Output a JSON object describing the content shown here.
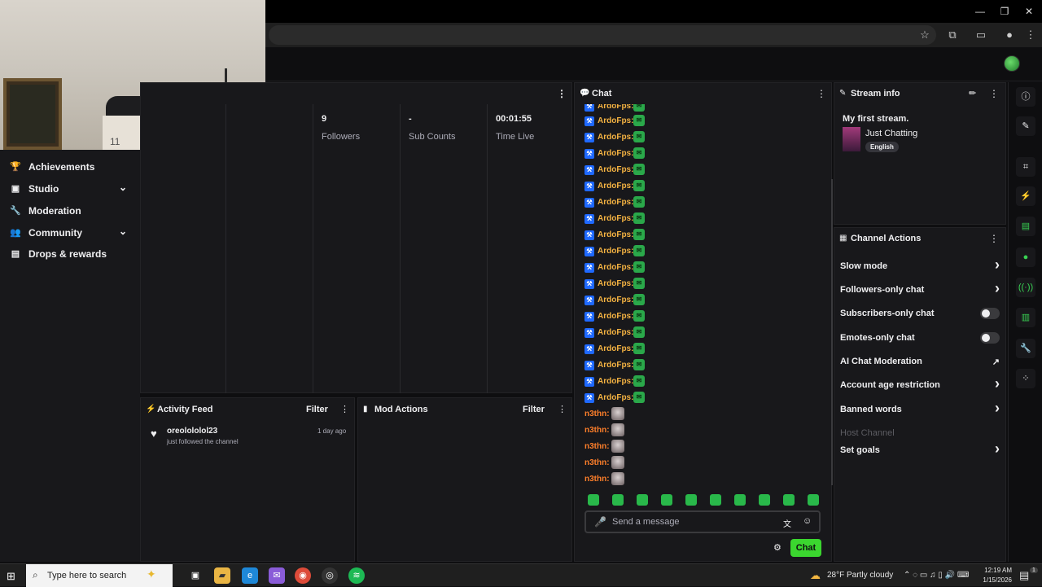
{
  "window": {
    "minimize": "—",
    "restore": "❐",
    "close": "✕"
  },
  "webcam": {
    "badge": "11"
  },
  "nav": [
    {
      "label": "Achievements",
      "icon": "trophy-icon",
      "glyph": "🏆",
      "chevron": ""
    },
    {
      "label": "Studio",
      "icon": "studio-icon",
      "glyph": "▣",
      "chevron": "⌄"
    },
    {
      "label": "Moderation",
      "icon": "wrench-icon",
      "glyph": "🔧",
      "chevron": ""
    },
    {
      "label": "Community",
      "icon": "community-icon",
      "glyph": "👥",
      "chevron": "⌄"
    },
    {
      "label": "Drops & rewards",
      "icon": "drops-icon",
      "glyph": "▤",
      "chevron": ""
    }
  ],
  "stats": [
    {
      "value": "9",
      "label": "Followers"
    },
    {
      "value": "-",
      "label": "Sub Counts"
    },
    {
      "value": "00:01:55",
      "label": "Time Live"
    }
  ],
  "activity": {
    "title": "Activity Feed",
    "filter": "Filter",
    "items": [
      {
        "user": "oreolololol23",
        "action": "just followed the channel",
        "time": "1 day ago"
      }
    ]
  },
  "modactions": {
    "title": "Mod Actions",
    "filter": "Filter"
  },
  "chat": {
    "title": "Chat",
    "partial_line": "ArdoFps:",
    "messages": [
      {
        "user": "ArdoFps:",
        "badge": true
      },
      {
        "user": "ArdoFps:",
        "badge": true
      },
      {
        "user": "ArdoFps:",
        "badge": true
      },
      {
        "user": "ArdoFps:",
        "badge": true
      },
      {
        "user": "ArdoFps:",
        "badge": true
      },
      {
        "user": "ArdoFps:",
        "badge": true
      },
      {
        "user": "ArdoFps:",
        "badge": true
      },
      {
        "user": "ArdoFps:",
        "badge": true
      },
      {
        "user": "ArdoFps:",
        "badge": true
      },
      {
        "user": "ArdoFps:",
        "badge": true
      },
      {
        "user": "ArdoFps:",
        "badge": true
      },
      {
        "user": "ArdoFps:",
        "badge": true
      },
      {
        "user": "ArdoFps:",
        "badge": true
      },
      {
        "user": "ArdoFps:",
        "badge": true
      },
      {
        "user": "ArdoFps:",
        "badge": true
      },
      {
        "user": "ArdoFps:",
        "badge": true
      },
      {
        "user": "ArdoFps:",
        "badge": true
      },
      {
        "user": "ArdoFps:",
        "badge": true
      },
      {
        "user": "n3thn:",
        "badge": false
      },
      {
        "user": "n3thn:",
        "badge": false
      },
      {
        "user": "n3thn:",
        "badge": false
      },
      {
        "user": "n3thn:",
        "badge": false
      },
      {
        "user": "n3thn:",
        "badge": false
      }
    ],
    "placeholder": "Send a message",
    "send_label": "Chat",
    "colors": {
      "ardo": "#f5b342",
      "n3thn": "#ff7f2a",
      "send": "#3bd62f"
    }
  },
  "streaminfo": {
    "header": "Stream info",
    "title": "My first stream.",
    "category": "Just Chatting",
    "tag": "English"
  },
  "channelactions": {
    "header": "Channel Actions",
    "rows": [
      {
        "label": "Slow mode",
        "control": "chevron"
      },
      {
        "label": "Followers-only chat",
        "control": "chevron"
      },
      {
        "label": "Subscribers-only chat",
        "control": "toggle"
      },
      {
        "label": "Emotes-only chat",
        "control": "toggle"
      },
      {
        "label": "AI Chat Moderation",
        "control": "external"
      },
      {
        "label": "Account age restriction",
        "control": "chevron"
      },
      {
        "label": "Banned words",
        "control": "chevron"
      },
      {
        "label": "Host Channel",
        "control": "disabled"
      },
      {
        "label": "Set goals",
        "control": "chevron"
      }
    ]
  },
  "taskbar": {
    "search_placeholder": "Type here to search",
    "weather": "28°F  Partly cloudy",
    "time": "12:19 AM",
    "date": "1/15/2026",
    "notifications": "1"
  }
}
